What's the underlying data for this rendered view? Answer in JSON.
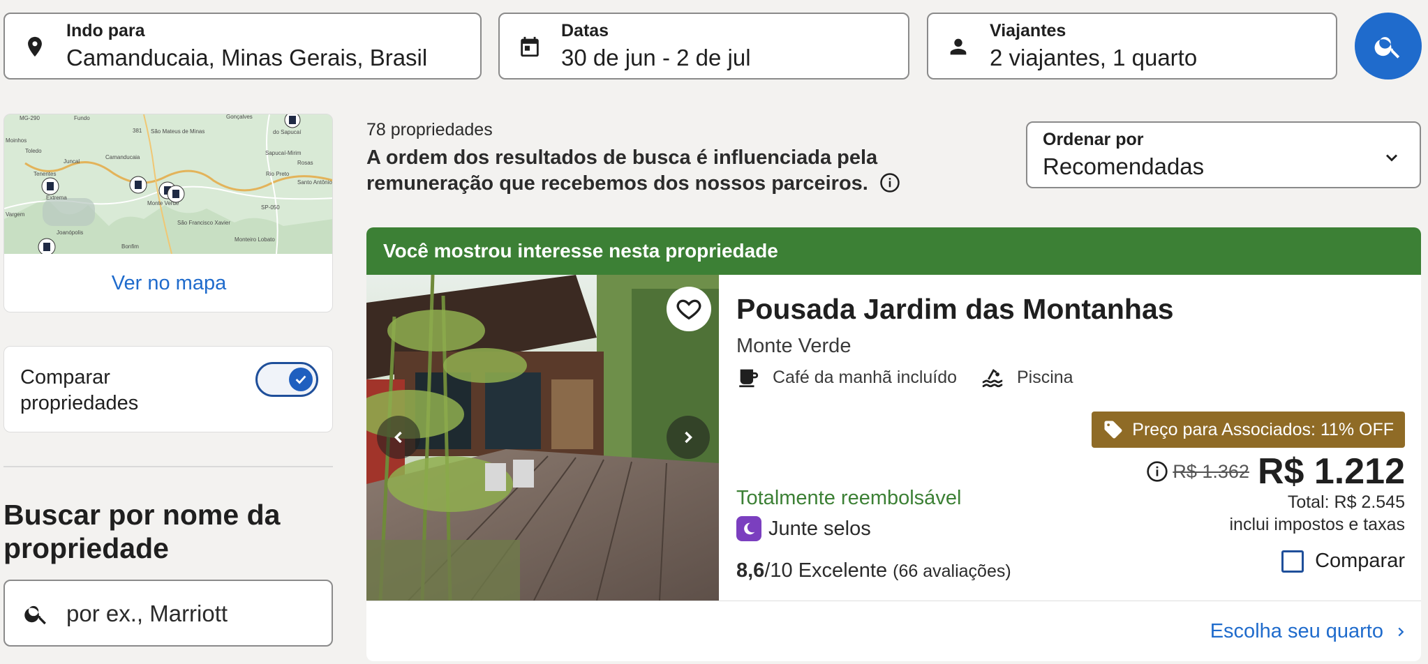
{
  "search": {
    "destination": {
      "label": "Indo para",
      "value": "Camanducaia, Minas Gerais, Brasil",
      "icon": "location-pin-icon"
    },
    "dates": {
      "label": "Datas",
      "value": "30 de jun - 2 de jul",
      "icon": "calendar-icon"
    },
    "travelers": {
      "label": "Viajantes",
      "value": "2 viajantes, 1 quarto",
      "icon": "person-icon"
    },
    "button_icon": "search-icon"
  },
  "sidebar": {
    "map": {
      "link": "Ver no mapa",
      "places": [
        "Fundo",
        "Gonçalves",
        "Moinhos",
        "São Mateus de Minas",
        "do Sapucaí",
        "Toledo",
        "Juncal",
        "Camanducaia",
        "Sapucaí-Mirim",
        "Rosas",
        "Extrema",
        "Rio Preto",
        "Santo Antônio do Pinhal",
        "Monte Verde",
        "Joanópolis",
        "São Francisco Xavier",
        "Monteiro Lobato",
        "Bonfim",
        "Vargem",
        "Tenentes",
        "SP-050",
        "MG-290",
        "381"
      ]
    },
    "compare": {
      "label": "Comparar propriedades",
      "enabled": true
    },
    "name_search": {
      "heading": "Buscar por nome da propriedade",
      "placeholder": "por ex., Marriott"
    }
  },
  "results": {
    "count": "78 propriedades",
    "disclaimer": "A ordem dos resultados de busca é influenciada pela remuneração que recebemos dos nossos parceiros.",
    "sort": {
      "label": "Ordenar por",
      "value": "Recomendadas"
    }
  },
  "property": {
    "banner": "Você mostrou interesse nesta propriedade",
    "name": "Pousada Jardim das Montanhas",
    "location": "Monte Verde",
    "amenities": [
      {
        "label": "Café da manhã incluído",
        "icon": "coffee-cup-icon"
      },
      {
        "label": "Piscina",
        "icon": "pool-icon"
      }
    ],
    "refund": "Totalmente reembolsável",
    "stamps": "Junte selos",
    "rating_score": "8,6",
    "rating_scale": "/10",
    "rating_word": "Excelente",
    "reviews": "(66 avaliações)",
    "member_badge": "Preço para Associados: 11% OFF",
    "old_price": "R$ 1.362",
    "price": "R$ 1.212",
    "total": "Total: R$ 2.545",
    "taxes": "inclui impostos e taxas",
    "compare_label": "Comparar",
    "compare_checked": false,
    "choose_room": "Escolha seu quarto",
    "favorite": false
  },
  "colors": {
    "accent": "#1f6bcc",
    "banner_green": "#3c8035",
    "member_gold": "#8f6b26",
    "stamps_purple": "#7b3fbf",
    "background": "#f3f2f0"
  }
}
